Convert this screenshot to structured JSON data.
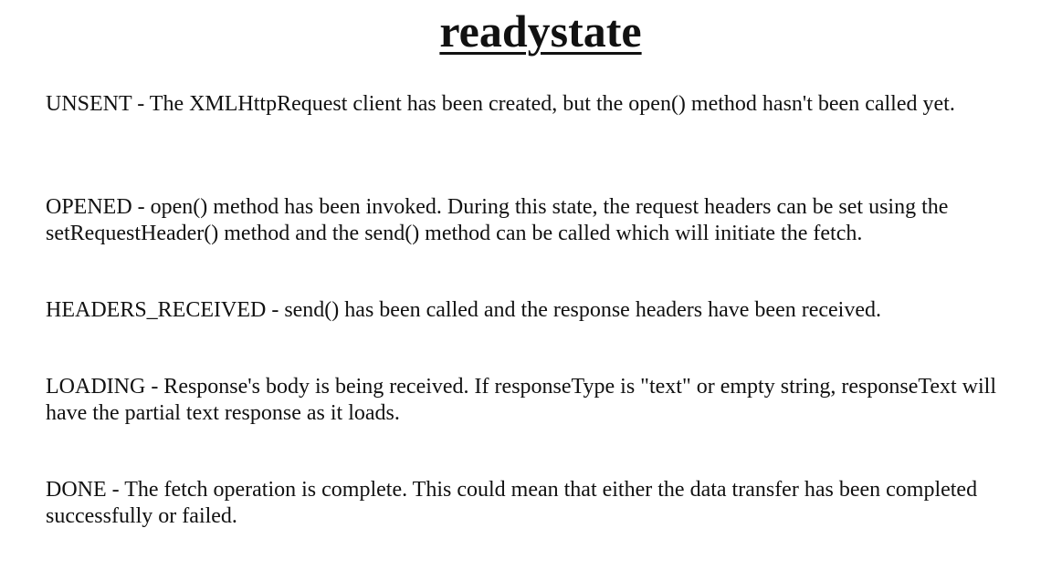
{
  "title": "readystate",
  "states": [
    {
      "text": "UNSENT - The XMLHttpRequest client has been created, but the open() method hasn't been called yet."
    },
    {
      "text": "OPENED - open() method has been invoked. During this state, the request headers can be set using the setRequestHeader() method and the send() method can be called which will initiate the fetch."
    },
    {
      "text": "HEADERS_RECEIVED - send() has been called and the response headers have been received."
    },
    {
      "text": "LOADING - Response's body is being received. If responseType is \"text\" or empty string, responseText will have the partial text response as it loads."
    },
    {
      "text": "DONE - The fetch operation is complete. This could mean that either the data transfer has been completed successfully or failed."
    }
  ]
}
